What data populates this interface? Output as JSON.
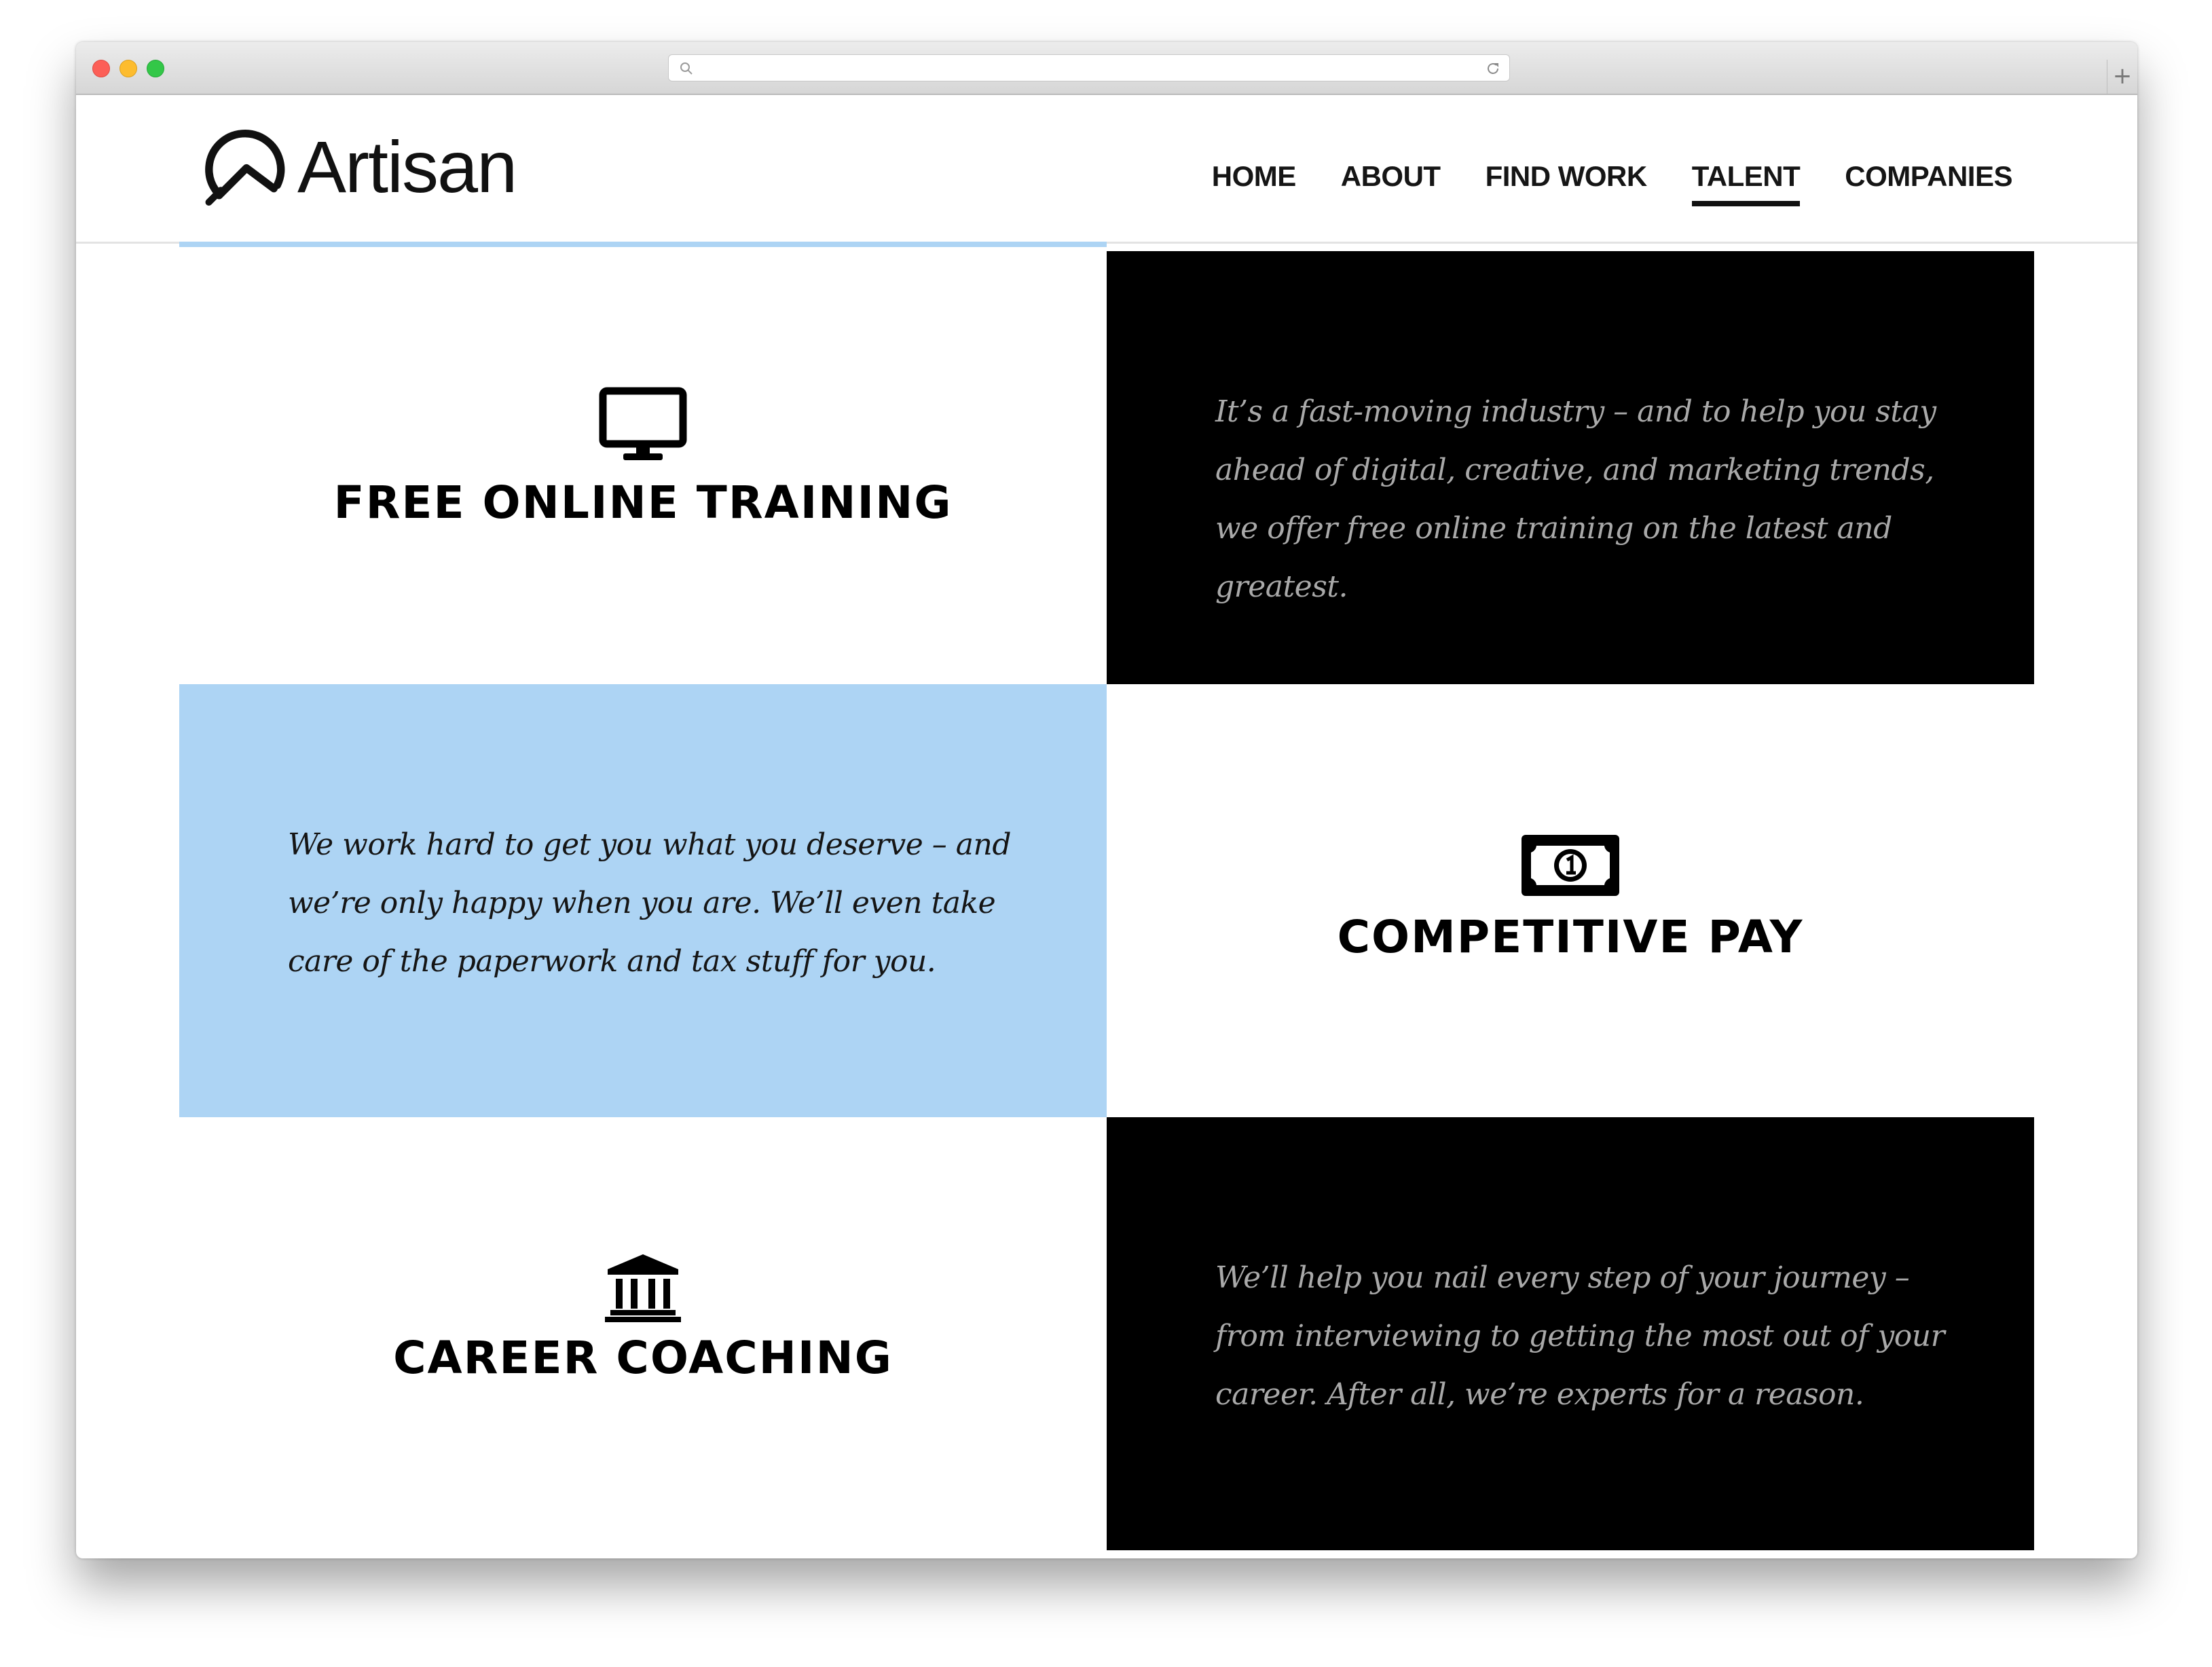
{
  "browser": {
    "url": "",
    "new_tab_label": "+"
  },
  "header": {
    "logo_text": "Artisan",
    "nav": [
      {
        "label": "HOME",
        "active": false
      },
      {
        "label": "ABOUT",
        "active": false
      },
      {
        "label": "FIND WORK",
        "active": false
      },
      {
        "label": "TALENT",
        "active": true
      },
      {
        "label": "COMPANIES",
        "active": false
      }
    ]
  },
  "features": [
    {
      "title": "FREE ONLINE TRAINING",
      "icon": "monitor-icon",
      "description": "It’s a fast-moving industry – and to help you stay ahead of digital, creative, and marketing trends, we offer free online training on the latest and greatest."
    },
    {
      "title": "COMPETITIVE PAY",
      "icon": "dollar-bill-icon",
      "description": "We work hard to get you what you deserve – and we’re only happy when you are. We’ll even take care of the paperwork and tax stuff for you."
    },
    {
      "title": "CAREER COACHING",
      "icon": "institution-icon",
      "description": "We’ll help you nail every step of your journey – from interviewing to getting the most out of your career. After all, we’re experts for a reason."
    }
  ],
  "colors": {
    "accent_blue": "#add4f4",
    "dark_panel": "#000000",
    "dark_panel_text": "#a9a9a9",
    "heading": "#000000"
  }
}
